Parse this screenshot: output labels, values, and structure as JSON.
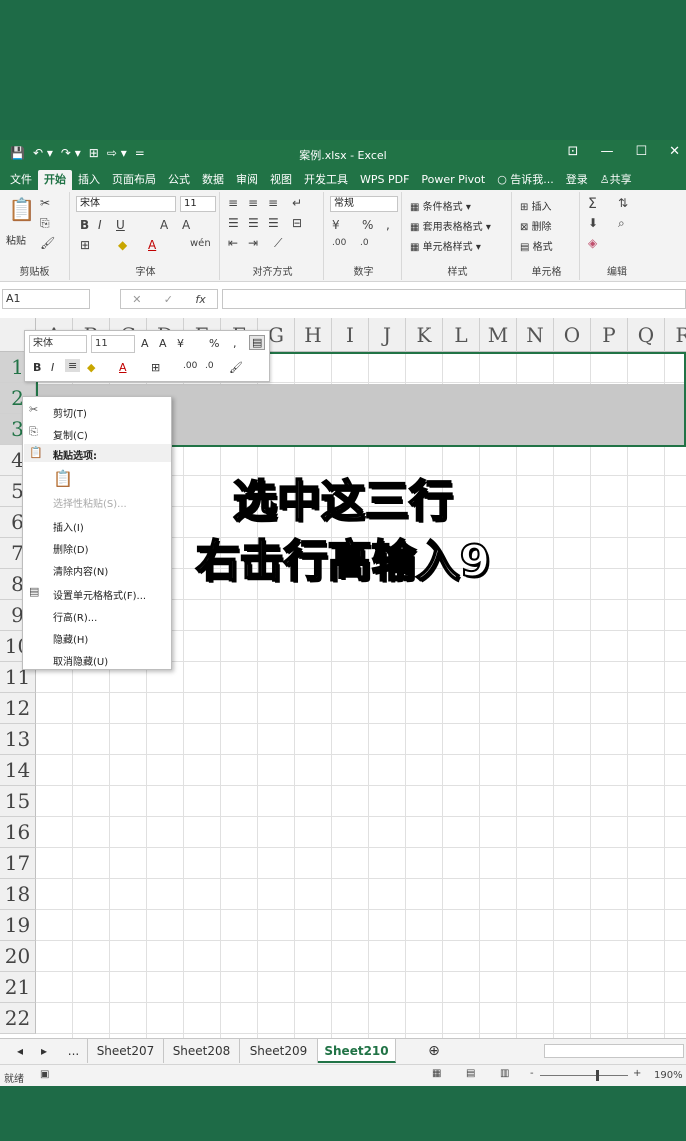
{
  "window": {
    "title": "案例.xlsx - Excel",
    "quick_access": [
      "💾",
      "↶ ▾",
      "↷ ▾",
      "⊞",
      "⇨ ▾",
      "="
    ],
    "controls": [
      "⊡",
      "—",
      "☐",
      "✕"
    ]
  },
  "menu": {
    "tabs": [
      "文件",
      "开始",
      "插入",
      "页面布局",
      "公式",
      "数据",
      "审阅",
      "视图",
      "开发工具",
      "WPS PDF",
      "Power Pivot"
    ],
    "tell_me": "告诉我...",
    "login": "登录",
    "share": "共享"
  },
  "ribbon": {
    "clipboard": {
      "label": "剪贴板",
      "paste": "粘贴"
    },
    "font": {
      "label": "字体",
      "font_name": "宋体",
      "font_size": "11"
    },
    "alignment": {
      "label": "对齐方式"
    },
    "number": {
      "label": "数字",
      "format": "常规"
    },
    "styles": {
      "label": "样式",
      "conditional": "条件格式 ▾",
      "table": "套用表格格式 ▾",
      "cell_style": "单元格样式 ▾"
    },
    "cells": {
      "label": "单元格",
      "insert": "插入",
      "delete": "删除",
      "format": "格式"
    },
    "editing": {
      "label": "编辑"
    }
  },
  "formula_bar": {
    "name_box": "A1",
    "fx": "fx",
    "cancel": "✕",
    "enter": "✓",
    "value": ""
  },
  "columns": [
    "A",
    "B",
    "C",
    "D",
    "E",
    "F",
    "G",
    "H",
    "I",
    "J",
    "K",
    "L",
    "M",
    "N",
    "O",
    "P",
    "Q",
    "R"
  ],
  "rows": [
    "1",
    "2",
    "3",
    "4",
    "5",
    "6",
    "7",
    "8",
    "9",
    "10",
    "11",
    "12",
    "13",
    "14",
    "15",
    "16",
    "17",
    "18",
    "19",
    "20",
    "21",
    "22"
  ],
  "selected_rows": [
    "1",
    "2",
    "3"
  ],
  "mini_toolbar": {
    "font_name": "宋体",
    "font_size": "11",
    "bold": "B",
    "italic": "I",
    "percent": "%",
    "comma": ","
  },
  "context_menu": {
    "cut": "剪切(T)",
    "copy": "复制(C)",
    "paste_options": "粘贴选项:",
    "paste_special": "选择性粘贴(S)...",
    "insert": "插入(I)",
    "delete": "删除(D)",
    "clear": "清除内容(N)",
    "format_cells": "设置单元格格式(F)...",
    "row_height": "行高(R)...",
    "hide": "隐藏(H)",
    "unhide": "取消隐藏(U)"
  },
  "sheets": {
    "nav_prev": "◂",
    "nav_next": "▸",
    "more": "...",
    "tabs": [
      "Sheet207",
      "Sheet208",
      "Sheet209",
      "Sheet210"
    ],
    "active": "Sheet210",
    "add": "⊕"
  },
  "status": {
    "mode": "就绪",
    "zoom": "190%",
    "zoom_minus": "-",
    "zoom_plus": "+"
  },
  "caption": {
    "line1": "选中这三行",
    "line2": "右击行高输入9"
  },
  "colors": {
    "excel_green": "#217346",
    "background": "#1e6b47"
  }
}
